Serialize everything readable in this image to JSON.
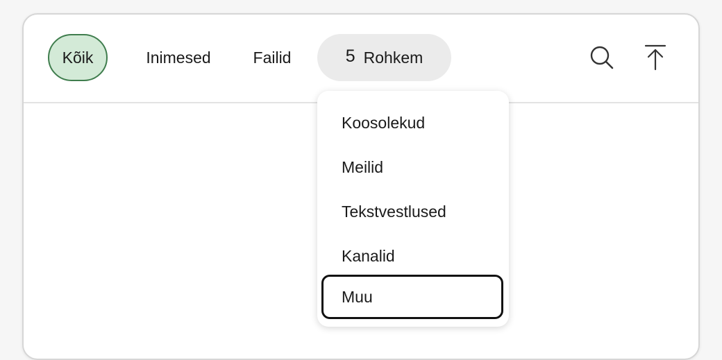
{
  "tabs": {
    "all": "Kõik",
    "people": "Inimesed",
    "files": "Failid",
    "more_count": "5",
    "more_label": "Rohkem"
  },
  "icons": {
    "search": "search-icon",
    "scroll_top": "arrow-up-to-top-icon"
  },
  "dropdown": {
    "items": [
      "Koosolekud",
      "Meilid",
      "Tekstvestlused",
      "Kanalid",
      "Muu"
    ],
    "focused": "Muu"
  },
  "colors": {
    "active_tab_bg": "#d3ead7",
    "active_tab_border": "#3f7d4d",
    "more_tab_bg": "#ebebeb"
  }
}
